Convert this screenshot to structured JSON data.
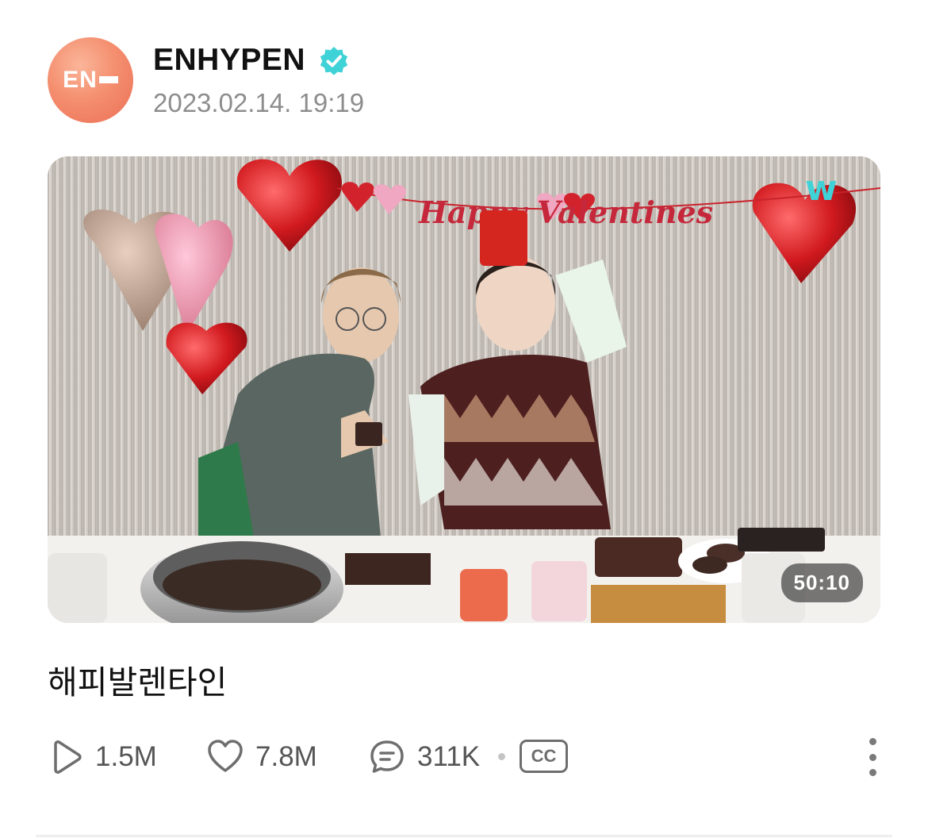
{
  "channel": {
    "name": "ENHYPEN",
    "avatar_logo": "EN",
    "verified_icon": "verified-badge-icon",
    "post_date": "2023.02.14. 19:19",
    "brand_color": "#ef7a5e",
    "verified_color": "#3fd2d6"
  },
  "video": {
    "title": "해피발렌타인",
    "duration": "50:10",
    "thumbnail_banner_text": "Happy Valentines",
    "watermark_letter": "w"
  },
  "stats": {
    "plays": "1.5M",
    "likes": "7.8M",
    "comments": "311K",
    "cc_label": "CC",
    "play_icon": "play-icon",
    "like_icon": "heart-icon",
    "comment_icon": "comment-icon",
    "more_icon": "more-vertical-icon"
  }
}
